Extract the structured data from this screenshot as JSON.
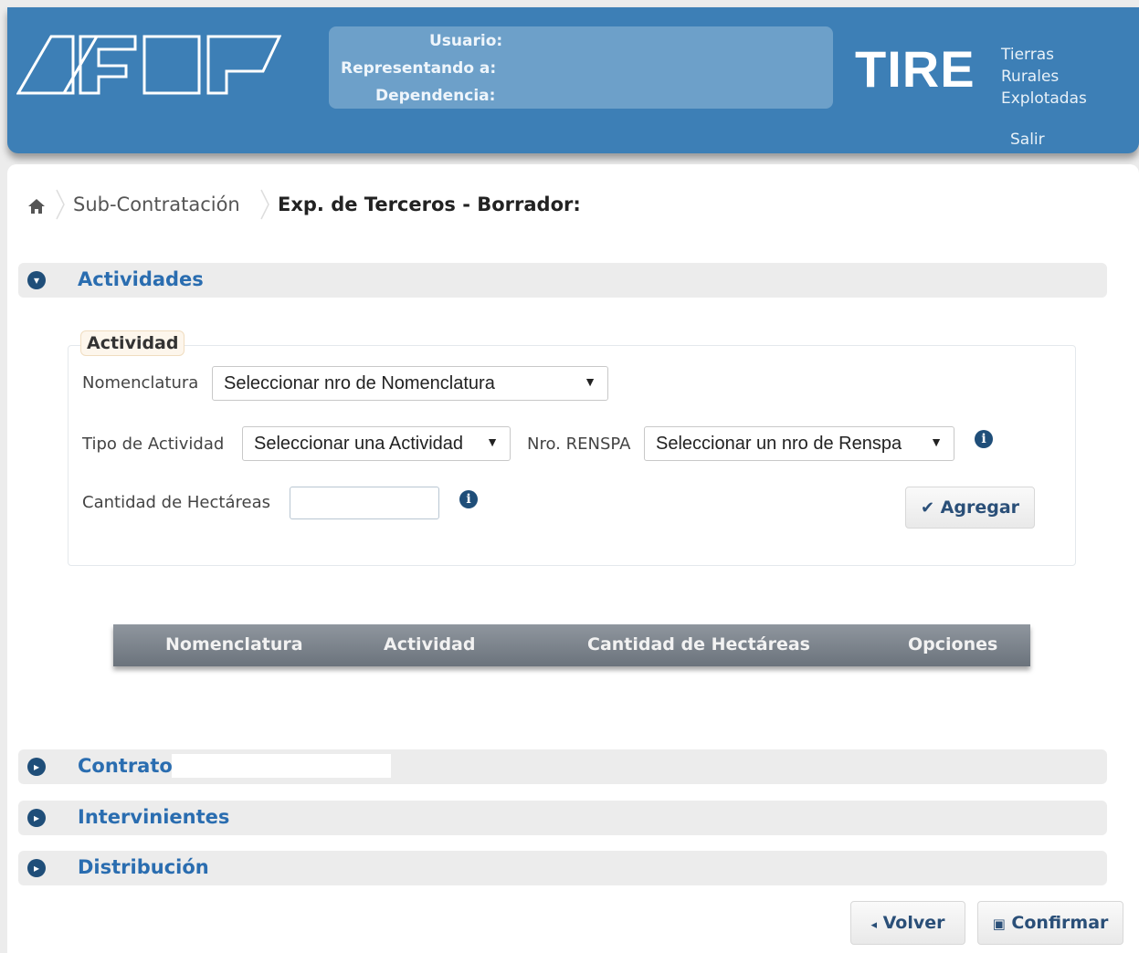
{
  "header": {
    "user_label": "Usuario:",
    "representing_label": "Representando a:",
    "dependency_label": "Dependencia:",
    "app_name": "TIRE",
    "app_subtitle": [
      "Tierras",
      "Rurales",
      "Explotadas"
    ],
    "logout": "Salir",
    "colors": {
      "header_bg": "#3d7fb6",
      "userbox_bg": "#6da0c9"
    }
  },
  "breadcrumb": {
    "home_icon": "home-icon",
    "items": [
      "Sub-Contratación",
      "Exp. de Terceros - Borrador:"
    ]
  },
  "sections": {
    "actividades": "Actividades",
    "contrato": "Contrato",
    "intervinientes": "Intervinientes",
    "distribucion": "Distribución"
  },
  "form": {
    "legend": "Actividad",
    "nomenclatura_label": "Nomenclatura",
    "nomenclatura_value": "Seleccionar nro de Nomenclatura",
    "tipo_label": "Tipo de Actividad",
    "tipo_value": "Seleccionar una Actividad",
    "renspa_label": "Nro. RENSPA",
    "renspa_value": "Seleccionar un nro de Renspa",
    "hectareas_label": "Cantidad de Hectáreas",
    "hectareas_value": "",
    "add_button": "Agregar"
  },
  "table": {
    "columns": [
      "Nomenclatura",
      "Actividad",
      "Cantidad de Hectáreas",
      "Opciones"
    ]
  },
  "footer": {
    "back_button": "Volver",
    "confirm_button": "Confirmar"
  }
}
